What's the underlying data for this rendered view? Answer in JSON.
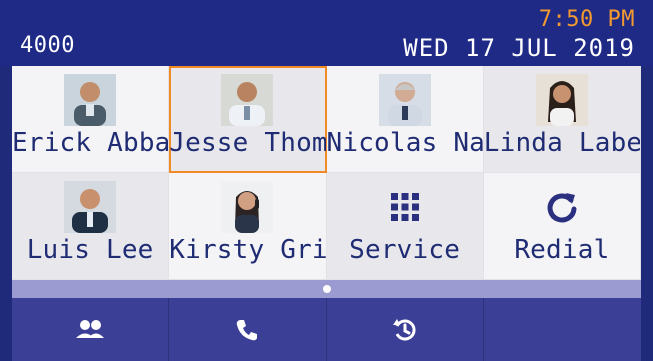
{
  "header": {
    "extension": "4000",
    "time": "7:50 PM",
    "date": "WED 17 JUL 2019"
  },
  "keys": [
    {
      "label": "Erick Abbas",
      "icon": "avatar-photo"
    },
    {
      "label": "Jesse Thomas",
      "icon": "avatar-photo",
      "selected": true
    },
    {
      "label": "Nicolas Nas",
      "icon": "avatar-photo"
    },
    {
      "label": "Linda Labe",
      "icon": "avatar-photo"
    },
    {
      "label": "Luis Lee",
      "icon": "avatar-photo"
    },
    {
      "label": "Kirsty Grim",
      "icon": "avatar-photo"
    },
    {
      "label": "Service",
      "icon": "keypad-grid-icon"
    },
    {
      "label": "Redial",
      "icon": "redial-icon"
    }
  ],
  "bottom_bar": {
    "buttons": [
      {
        "icon": "contacts-icon"
      },
      {
        "icon": "phone-icon"
      },
      {
        "icon": "history-icon"
      },
      {
        "icon": "empty"
      }
    ]
  },
  "colors": {
    "header_bg": "#1e2a86",
    "time": "#f29a2f",
    "key_label": "#1f2c73",
    "selection": "#f08a24",
    "bottom_bar": "#3c3f96"
  }
}
